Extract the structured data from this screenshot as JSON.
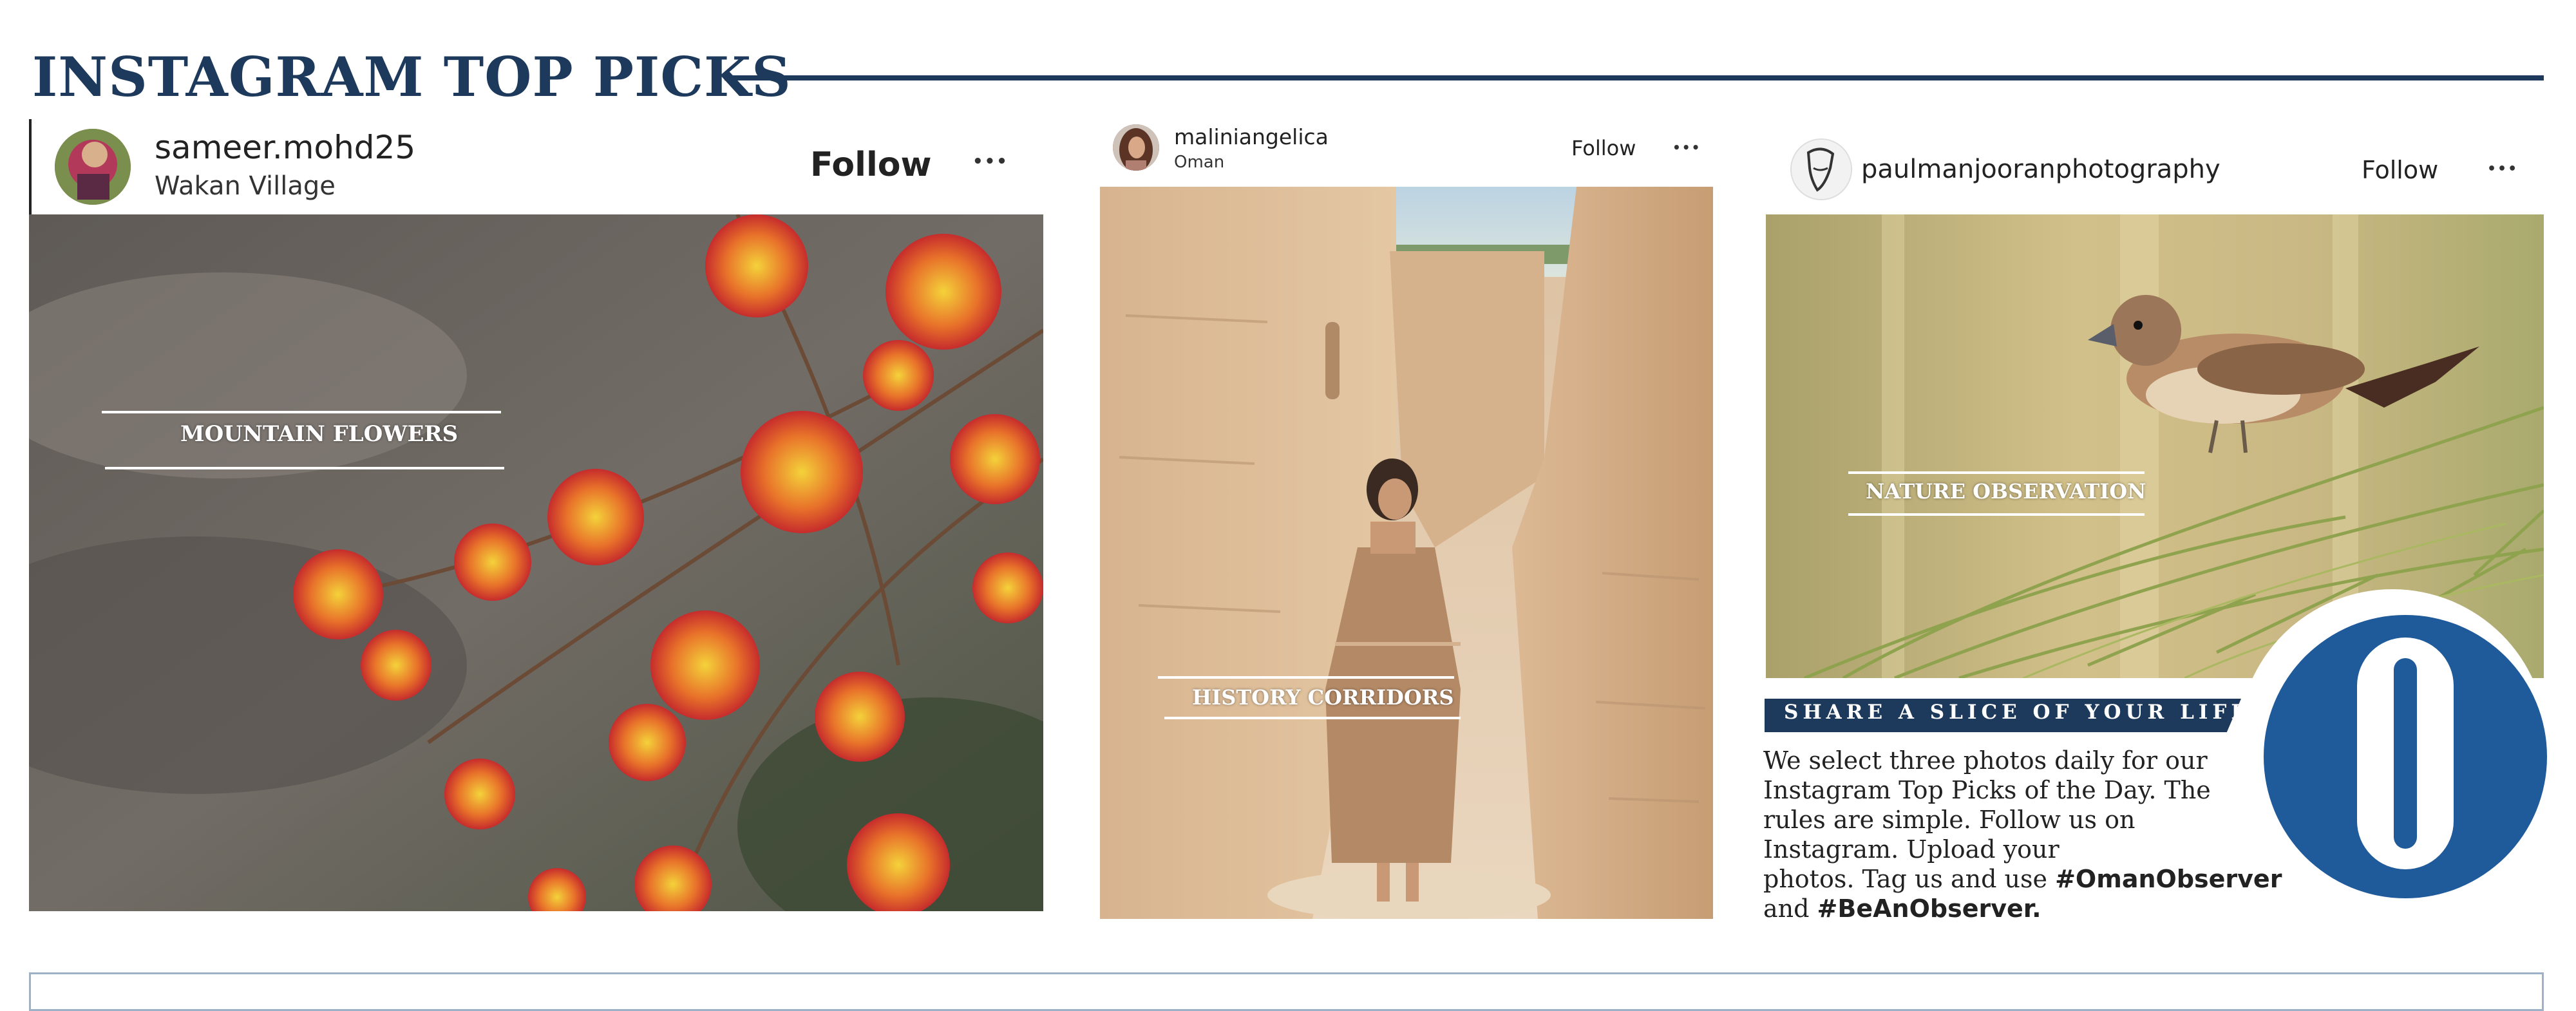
{
  "page": {
    "title": "INSTAGRAM TOP PICKS"
  },
  "posts": [
    {
      "username": "sameer.mohd25",
      "location": "Wakan Village",
      "follow_label": "Follow",
      "more_label": "•••",
      "caption": "MOUNTAIN FLOWERS"
    },
    {
      "username": "maliniangelica",
      "location": "Oman",
      "follow_label": "Follow",
      "more_label": "•••",
      "caption": "HISTORY CORRIDORS"
    },
    {
      "username": "paulmanjooranphotography",
      "follow_label": "Follow",
      "more_label": "•••",
      "caption": "NATURE OBSERVATION"
    }
  ],
  "share": {
    "banner": "SHARE A SLICE OF YOUR LIFE",
    "lines": [
      "We select three photos daily for our",
      "Instagram Top Picks of the Day. The",
      "rules are simple. Follow us on",
      "Instagram. Upload your"
    ],
    "line5_prefix": "photos. Tag us and use ",
    "hashtag1": "#OmanObserver",
    "line6_prefix": "and ",
    "hashtag2": "#BeAnObserver."
  },
  "colors": {
    "navy": "#1d3a5c",
    "logo_blue": "#1f5a9a"
  }
}
